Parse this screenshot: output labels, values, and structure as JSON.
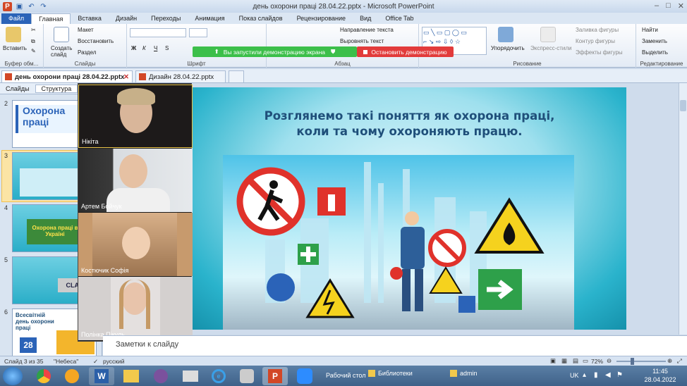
{
  "window": {
    "title": "день охорони праці 28.04.22.pptx - Microsoft PowerPoint"
  },
  "ribbon_tabs": [
    "Файл",
    "Главная",
    "Вставка",
    "Дизайн",
    "Переходы",
    "Анимация",
    "Показ слайдов",
    "Рецензирование",
    "Вид",
    "Office Tab"
  ],
  "ribbon": {
    "paste": "Вставить",
    "clipboard_label": "Буфер обм...",
    "new_slide": "Создать слайд",
    "layout": "Макет",
    "restore": "Восстановить",
    "section": "Раздел",
    "slides_label": "Слайды",
    "font_label": "Шрифт",
    "text_direction": "Направление текста",
    "align_text": "Выровнять текст",
    "paragraph_label": "Абзац",
    "arrange": "Упорядочить",
    "quick_styles": "Экспресс-стили",
    "shape_fill": "Заливка фигуры",
    "shape_outline": "Контур фигуры",
    "shape_effects": "Эффекты фигуры",
    "drawing_label": "Рисование",
    "find": "Найти",
    "replace": "Заменить",
    "select": "Выделить",
    "editing_label": "Редактирование",
    "font_buttons": [
      "Ж",
      "К",
      "Ч",
      "S"
    ]
  },
  "screen_share": {
    "status": "Вы запустили демонстрацию экрана",
    "stop": "Остановить демонстрацию"
  },
  "doc_tabs": [
    {
      "label": "день охорони праці 28.04.22.pptx",
      "active": true
    },
    {
      "label": "Дизайн 28.04.22.pptx",
      "active": false
    }
  ],
  "left_pane": {
    "tabs": [
      "Слайды",
      "Структура"
    ],
    "slides": [
      {
        "num": "2",
        "text": "Охорона праці"
      },
      {
        "num": "3",
        "text": "",
        "selected": true
      },
      {
        "num": "4",
        "text": "Охорона праці в Україні"
      },
      {
        "num": "5",
        "text": "CLAI"
      },
      {
        "num": "6",
        "text": "Всесвітній день охорони праці",
        "date": "28"
      }
    ]
  },
  "participants": [
    {
      "name": "Нікіта"
    },
    {
      "name": "Артем Бойчук"
    },
    {
      "name": "Костючик Софія"
    },
    {
      "name": "Полінка Пікуль"
    }
  ],
  "slide": {
    "title_line1": "Розглянемо такі поняття як охорона праці,",
    "title_line2": "коли та чому охороняють працю."
  },
  "notes": {
    "placeholder": "Заметки к слайду"
  },
  "status_bar": {
    "slide_info": "Слайд 3 из 35",
    "theme": "\"Небеса\"",
    "language": "русский",
    "zoom": "72%"
  },
  "taskbar": {
    "desktop": "Рабочий стол",
    "libraries": "Библиотеки",
    "admin": "admin",
    "lang": "UK",
    "time": "11:45",
    "date": "28.04.2022"
  },
  "colors": {
    "file_tab": "#2b63b8",
    "share_green": "#3cbf4a",
    "stop_red": "#e23b3b",
    "slide_title": "#1f4f7a"
  }
}
